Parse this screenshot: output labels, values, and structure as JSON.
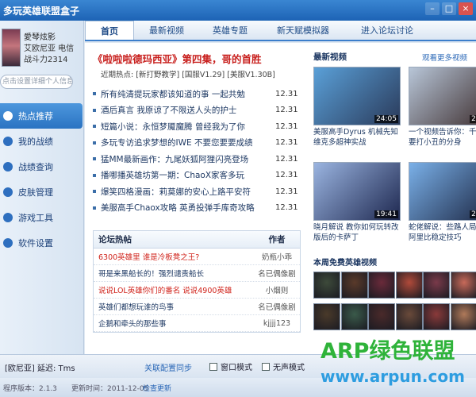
{
  "window": {
    "title": "多玩英雄联盟盒子"
  },
  "profile": {
    "name": "愛琴炫影",
    "server": "艾欧尼亚 电信",
    "power": "战斗力2314",
    "signature": "点击设置详细个人信息"
  },
  "sidebar": {
    "items": [
      {
        "label": "热点推荐",
        "icon": "flame-icon",
        "active": true
      },
      {
        "label": "我的战绩",
        "icon": "trophy-icon",
        "active": false
      },
      {
        "label": "战绩查询",
        "icon": "search-icon",
        "active": false
      },
      {
        "label": "皮肤管理",
        "icon": "skin-icon",
        "active": false
      },
      {
        "label": "游戏工具",
        "icon": "tool-icon",
        "active": false
      },
      {
        "label": "软件设置",
        "icon": "gear-icon",
        "active": false
      }
    ]
  },
  "tabs": [
    {
      "label": "首页",
      "active": true
    },
    {
      "label": "最新视频",
      "active": false
    },
    {
      "label": "英雄专题",
      "active": false
    },
    {
      "label": "新天赋模拟器",
      "active": false
    },
    {
      "label": "进入论坛讨论",
      "active": false
    }
  ],
  "headline": "《啦啦啦德玛西亚》第四集，哥的首胜",
  "hotline": {
    "label": "近期热点:",
    "items": [
      "[新打野教学]",
      "[国服V1.29]",
      "[美服V1.30B]"
    ]
  },
  "news": [
    {
      "title": "所有纯清提玩家都该知道的事 一起共勉",
      "date": "12.31"
    },
    {
      "title": "酒后真言 我原谅了不限送人头的护士",
      "date": "12.31"
    },
    {
      "title": "短篇小说：永恒梦魇魔腾 曾经我为了你",
      "date": "12.31"
    },
    {
      "title": "多玩专访追求梦想的IWE 不要您要要成绩",
      "date": "12.31"
    },
    {
      "title": "猛MM最新画作：九尾妖狐阿狸闪亮登场",
      "date": "12.31"
    },
    {
      "title": "播哪播英雄坊第一期：ChaoX家客多玩",
      "date": "12.31"
    },
    {
      "title": "爆笑四格漫画：莉莫娜的安心上路平安符",
      "date": "12.31"
    },
    {
      "title": "美服高手Chaox攻略 英勇投弹手库奇攻略",
      "date": "12.31"
    }
  ],
  "forum": {
    "header_title": "论坛热帖",
    "header_author": "作者",
    "rows": [
      {
        "title": "6300英雄里 谁是冷板凳之王?",
        "author": "奶瓶小乖",
        "red": true
      },
      {
        "title": "哥是来黑船长的！强烈谴责船长",
        "author": "名已偶像剧",
        "red": false
      },
      {
        "title": "说说LOL英雄你们的番名 说说4900英雄",
        "author": "小烟则",
        "red": true
      },
      {
        "title": "英雄们都想玩谁的鸟事",
        "author": "名已偶像剧",
        "red": false
      },
      {
        "title": "企鹅和牵头的那些事",
        "author": "kjjjj123",
        "red": false
      }
    ]
  },
  "videos": {
    "title": "最新视频",
    "more": "观看更多视频",
    "items": [
      {
        "caption": "美服高手Dyrus 机械先知维克多超神实战",
        "duration": "24:05",
        "colors": [
          "#5aa0d8",
          "#2a3a5a"
        ]
      },
      {
        "caption": "一个视频告诉你：千万不要打小丑的分身",
        "duration": "24:05",
        "colors": [
          "#b8c6d8",
          "#3a2a2a"
        ]
      },
      {
        "caption": "晓月解说 教你如何玩转改版后的卡萨丁",
        "duration": "19:41",
        "colors": [
          "#9ab4e0",
          "#1e2850"
        ]
      },
      {
        "caption": "蛇佬解说：些路人局独练阿里比稳定技巧",
        "duration": "24:05",
        "colors": [
          "#7ab0e8",
          "#1a2440"
        ]
      }
    ]
  },
  "heroes": {
    "title": "本周免费英雄视频",
    "colors": [
      "#3d4a3a",
      "#5a3a2a",
      "#6a2a3a",
      "#b04a3a",
      "#7a3a4a",
      "#c86a5a",
      "#4a3a2a",
      "#3a5a4a",
      "#4a2a2a",
      "#6a4a3a",
      "#8a3a3a",
      "#b07a5a"
    ]
  },
  "status": {
    "user": "[欧尼亚] 延迟: Tms",
    "skin_sync": "关联配置同步",
    "window_mode": "窗口模式",
    "silent_mode": "无声模式"
  },
  "footer": {
    "version": "程序版本：2.1.3",
    "updated": "更新时间：2011-12-05",
    "check": "检查更新"
  },
  "watermark": {
    "line1": "ARP绿色联盟",
    "line2": "www.arpun.com"
  }
}
